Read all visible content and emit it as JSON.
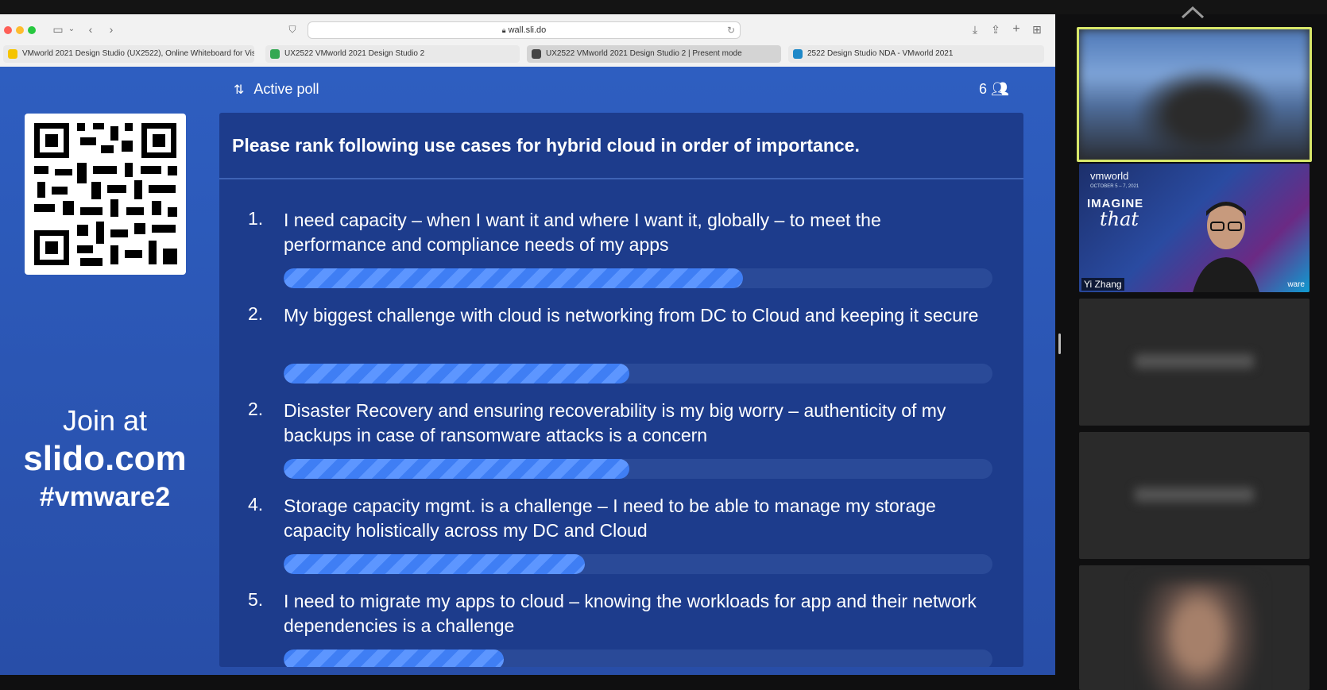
{
  "browser": {
    "url": "wall.sli.do",
    "tabs": [
      {
        "label": "VMworld 2021 Design Studio (UX2522), Online Whiteboard for Vis...",
        "favicon_color": "#f5c400"
      },
      {
        "label": "UX2522 VMworld 2021 Design Studio 2",
        "favicon_color": "#35a853"
      },
      {
        "label": "UX2522 VMworld 2021 Design Studio 2 | Present mode",
        "favicon_color": "#444444",
        "active": true
      },
      {
        "label": "2522 Design Studio NDA - VMworld 2021",
        "favicon_color": "#1e88c8"
      }
    ]
  },
  "slide": {
    "poll_label": "Active poll",
    "participant_count": "6",
    "join": {
      "line1": "Join at",
      "line2": "slido.com",
      "line3": "#vmware2"
    },
    "question": "Please rank following use cases for hybrid cloud in order of importance.",
    "items": [
      {
        "rank": "1.",
        "text": "I need capacity – when I want it and where I want it, globally – to meet the performance and compliance needs of my apps",
        "fraction": 0.648
      },
      {
        "rank": "2.",
        "text": "My biggest challenge with cloud is networking from DC to Cloud and keeping it secure",
        "fraction": 0.488
      },
      {
        "rank": "2.",
        "text": "Disaster Recovery and ensuring recoverability is my big worry – authenticity of my backups in case of ransomware attacks is a concern",
        "fraction": 0.488
      },
      {
        "rank": "4.",
        "text": "Storage capacity mgmt. is a challenge – I need to be able to manage my storage capacity holistically across my DC and Cloud",
        "fraction": 0.425
      },
      {
        "rank": "5.",
        "text": "I need to migrate my apps to cloud – knowing the workloads for app and their network dependencies is a challenge",
        "fraction": 0.31
      }
    ]
  },
  "side_panel": {
    "speaker_name": "Yi Zhang",
    "vm_brand": "vmworld",
    "vm_date": "OCTOBER 5 – 7, 2021",
    "vm_imagine": "IMAGINE",
    "vm_that": "that",
    "vm_tag": "ware"
  },
  "colors": {
    "slide_bg": "#2b57b6",
    "card_bg": "#1d3c8c",
    "bar_fill": "#3f7ef4",
    "selected_border": "#d8e76a"
  }
}
